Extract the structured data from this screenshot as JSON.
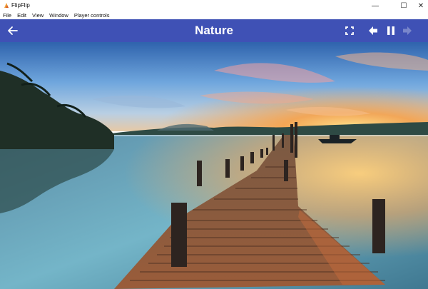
{
  "window": {
    "title": "FlipFlip",
    "controls": {
      "minimize": "—",
      "maximize": "☐",
      "close": "✕"
    }
  },
  "menu": {
    "items": [
      {
        "label": "File"
      },
      {
        "label": "Edit"
      },
      {
        "label": "View"
      },
      {
        "label": "Window"
      },
      {
        "label": "Player controls"
      }
    ]
  },
  "player": {
    "title": "Nature",
    "accent_color": "#3f51b5",
    "buttons": {
      "back": "arrow-back-icon",
      "fullscreen": "fullscreen-icon",
      "previous": "arrow-left-icon",
      "pause": "pause-icon",
      "next": "arrow-right-icon"
    }
  },
  "image": {
    "subject": "wooden pier over lake at sunset",
    "colors": {
      "sky_top": "#3a6fb8",
      "sky_mid": "#7fb2e0",
      "sunset": "#f6a64a",
      "water": "#4f8ea6",
      "pier": "#8a5a3b"
    }
  }
}
